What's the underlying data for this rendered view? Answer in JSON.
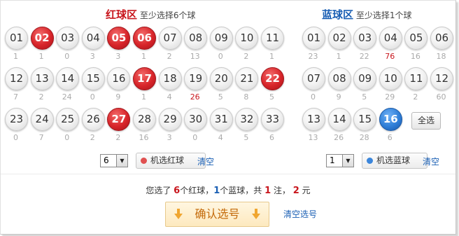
{
  "red": {
    "title": "红球区",
    "hint": "至少选择6个球",
    "balls": [
      {
        "n": "01",
        "miss": "1",
        "sel": false,
        "hot": false
      },
      {
        "n": "02",
        "miss": "1",
        "sel": true,
        "hot": false
      },
      {
        "n": "03",
        "miss": "0",
        "sel": false,
        "hot": false
      },
      {
        "n": "04",
        "miss": "3",
        "sel": false,
        "hot": false
      },
      {
        "n": "05",
        "miss": "3",
        "sel": true,
        "hot": false
      },
      {
        "n": "06",
        "miss": "1",
        "sel": true,
        "hot": false
      },
      {
        "n": "07",
        "miss": "2",
        "sel": false,
        "hot": false
      },
      {
        "n": "08",
        "miss": "13",
        "sel": false,
        "hot": false
      },
      {
        "n": "09",
        "miss": "0",
        "sel": false,
        "hot": false
      },
      {
        "n": "10",
        "miss": "2",
        "sel": false,
        "hot": false
      },
      {
        "n": "11",
        "miss": "1",
        "sel": false,
        "hot": false
      },
      {
        "n": "12",
        "miss": "7",
        "sel": false,
        "hot": false
      },
      {
        "n": "13",
        "miss": "2",
        "sel": false,
        "hot": false
      },
      {
        "n": "14",
        "miss": "24",
        "sel": false,
        "hot": false
      },
      {
        "n": "15",
        "miss": "0",
        "sel": false,
        "hot": false
      },
      {
        "n": "16",
        "miss": "9",
        "sel": false,
        "hot": false
      },
      {
        "n": "17",
        "miss": "1",
        "sel": true,
        "hot": false
      },
      {
        "n": "18",
        "miss": "4",
        "sel": false,
        "hot": false
      },
      {
        "n": "19",
        "miss": "26",
        "sel": false,
        "hot": true
      },
      {
        "n": "20",
        "miss": "5",
        "sel": false,
        "hot": false
      },
      {
        "n": "21",
        "miss": "8",
        "sel": false,
        "hot": false
      },
      {
        "n": "22",
        "miss": "5",
        "sel": true,
        "hot": false
      },
      {
        "n": "23",
        "miss": "0",
        "sel": false,
        "hot": false
      },
      {
        "n": "24",
        "miss": "7",
        "sel": false,
        "hot": false
      },
      {
        "n": "25",
        "miss": "0",
        "sel": false,
        "hot": false
      },
      {
        "n": "26",
        "miss": "2",
        "sel": false,
        "hot": false
      },
      {
        "n": "27",
        "miss": "2",
        "sel": true,
        "hot": false
      },
      {
        "n": "28",
        "miss": "16",
        "sel": false,
        "hot": false
      },
      {
        "n": "29",
        "miss": "3",
        "sel": false,
        "hot": false
      },
      {
        "n": "30",
        "miss": "0",
        "sel": false,
        "hot": false
      },
      {
        "n": "31",
        "miss": "4",
        "sel": false,
        "hot": false
      },
      {
        "n": "32",
        "miss": "5",
        "sel": false,
        "hot": false
      },
      {
        "n": "33",
        "miss": "6",
        "sel": false,
        "hot": false
      }
    ],
    "select_value": "6",
    "random_label": "机选红球",
    "clear_label": "清空",
    "accent": "#c8161d"
  },
  "blue": {
    "title": "蓝球区",
    "hint": "至少选择1个球",
    "balls": [
      {
        "n": "01",
        "miss": "23",
        "sel": false,
        "hot": false
      },
      {
        "n": "02",
        "miss": "1",
        "sel": false,
        "hot": false
      },
      {
        "n": "03",
        "miss": "22",
        "sel": false,
        "hot": false
      },
      {
        "n": "04",
        "miss": "76",
        "sel": false,
        "hot": true
      },
      {
        "n": "05",
        "miss": "16",
        "sel": false,
        "hot": false
      },
      {
        "n": "06",
        "miss": "18",
        "sel": false,
        "hot": false
      },
      {
        "n": "07",
        "miss": "0",
        "sel": false,
        "hot": false
      },
      {
        "n": "08",
        "miss": "9",
        "sel": false,
        "hot": false
      },
      {
        "n": "09",
        "miss": "5",
        "sel": false,
        "hot": false
      },
      {
        "n": "10",
        "miss": "29",
        "sel": false,
        "hot": false
      },
      {
        "n": "11",
        "miss": "2",
        "sel": false,
        "hot": false
      },
      {
        "n": "12",
        "miss": "60",
        "sel": false,
        "hot": false
      },
      {
        "n": "13",
        "miss": "13",
        "sel": false,
        "hot": false
      },
      {
        "n": "14",
        "miss": "26",
        "sel": false,
        "hot": false
      },
      {
        "n": "15",
        "miss": "28",
        "sel": false,
        "hot": false
      },
      {
        "n": "16",
        "miss": "6",
        "sel": true,
        "hot": false
      }
    ],
    "select_all_label": "全选",
    "select_value": "1",
    "random_label": "机选蓝球",
    "clear_label": "清空",
    "accent": "#1a5fb4"
  },
  "summary": {
    "p1": "您选了 ",
    "red_count": "6",
    "p2": "个红球，",
    "blue_count": "1",
    "p3": "个蓝球，共 ",
    "bets": "1",
    "p4": " 注， ",
    "amount": "2",
    "p5": " 元"
  },
  "confirm_label": "确认选号",
  "clear_all_label": "清空选号"
}
